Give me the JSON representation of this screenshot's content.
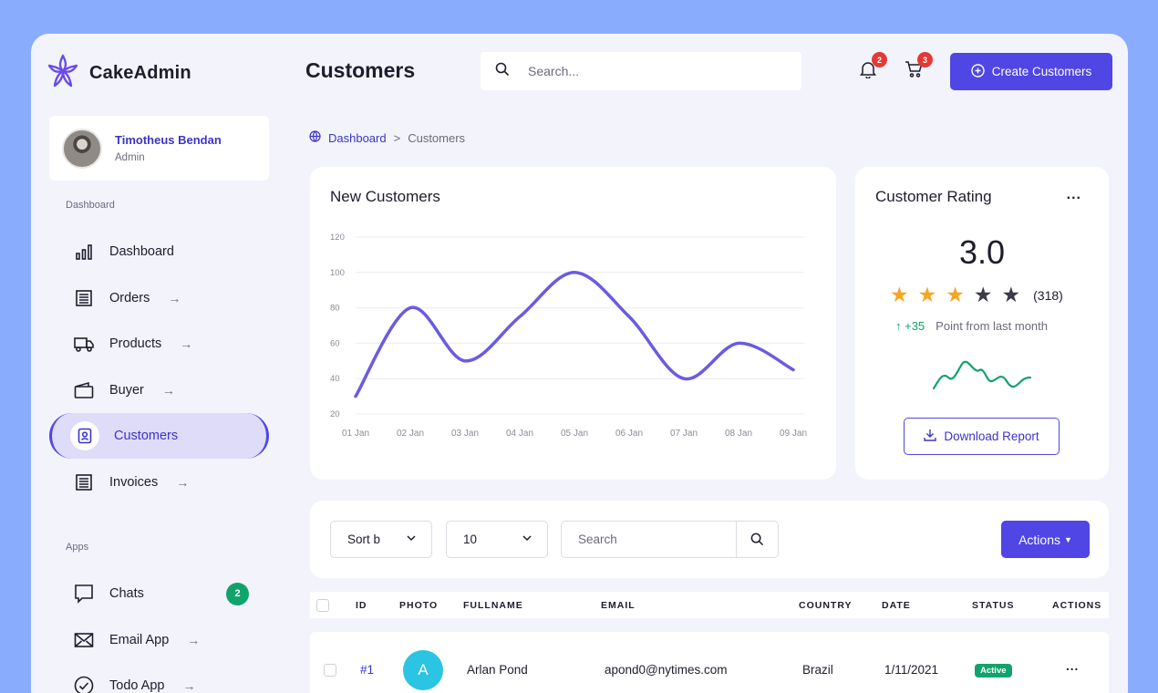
{
  "brand": {
    "name": "CakeAdmin"
  },
  "profile": {
    "name": "Timotheus Bendan",
    "role": "Admin"
  },
  "sidebar": {
    "section_dashboard": "Dashboard",
    "section_apps": "Apps",
    "items": [
      {
        "label": "Dashboard"
      },
      {
        "label": "Orders",
        "arrow": "→"
      },
      {
        "label": "Products",
        "arrow": "→"
      },
      {
        "label": "Buyer",
        "arrow": "→"
      },
      {
        "label": "Customers",
        "active": true
      },
      {
        "label": "Invoices",
        "arrow": "→"
      }
    ],
    "apps": [
      {
        "label": "Chats",
        "badge": "2"
      },
      {
        "label": "Email App",
        "arrow": "→"
      },
      {
        "label": "Todo App",
        "arrow": "→"
      }
    ]
  },
  "header": {
    "title": "Customers",
    "search_placeholder": "Search...",
    "notifications_count": "2",
    "cart_count": "3",
    "create_label": "Create Customers"
  },
  "breadcrumb": {
    "home": "Dashboard",
    "separator": ">",
    "current": "Customers"
  },
  "new_customers": {
    "title": "New Customers",
    "chart_data": {
      "type": "line",
      "x": [
        "01 Jan",
        "02 Jan",
        "03 Jan",
        "04 Jan",
        "05 Jan",
        "06 Jan",
        "07 Jan",
        "08 Jan",
        "09 Jan"
      ],
      "series": [
        {
          "values": [
            30,
            80,
            50,
            75,
            100,
            75,
            40,
            60,
            45
          ]
        }
      ],
      "yticks": [
        20,
        40,
        60,
        80,
        100,
        120
      ],
      "ylim": [
        20,
        120
      ],
      "grid": true,
      "color": "#6a5be2"
    }
  },
  "rating": {
    "title": "Customer Rating",
    "more": "...",
    "value": "3.0",
    "stars_filled": 3,
    "stars_total": 5,
    "count": "(318)",
    "delta": "↑ +35",
    "delta_text": "Point from last month",
    "download_label": "Download Report",
    "colors": {
      "star": "#f5a623",
      "star_empty": "#3a3a48",
      "trend": "#10a36b"
    }
  },
  "filters": {
    "sort_label": "Sort b",
    "per_page": "10",
    "search_placeholder": "Search",
    "actions_label": "Actions"
  },
  "table": {
    "headers": [
      "ID",
      "PHOTO",
      "FULLNAME",
      "EMAIL",
      "COUNTRY",
      "DATE",
      "STATUS",
      "ACTIONS"
    ],
    "rows": [
      {
        "id": "#1",
        "initial": "A",
        "fullname": "Arlan Pond",
        "email": "apond0@nytimes.com",
        "country": "Brazil",
        "date": "1/11/2021",
        "status": "Active",
        "actions": "..."
      }
    ]
  },
  "colors": {
    "accent": "#4f46e5",
    "accent_text": "#3b35c9",
    "success": "#10a36b",
    "danger": "#e53935"
  }
}
